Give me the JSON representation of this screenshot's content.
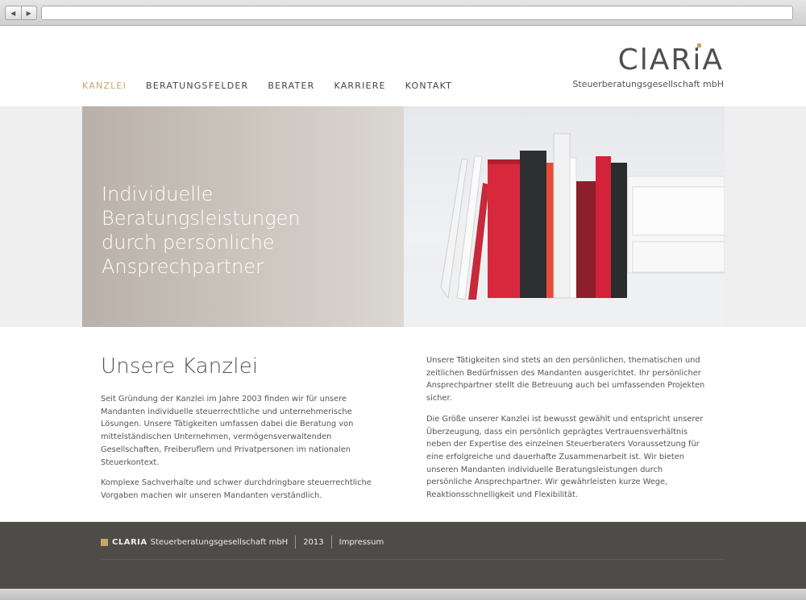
{
  "browser": {
    "back_label": "◀",
    "forward_label": "▶",
    "url": ""
  },
  "logo": {
    "wordmark": "ClARiA",
    "subtitle": "Steuerberatungsgesellschaft mbH"
  },
  "nav": {
    "items": [
      {
        "label": "KANZLEI",
        "active": true
      },
      {
        "label": "BERATUNGSFELDER"
      },
      {
        "label": "BERATER"
      },
      {
        "label": "KARRIERE"
      },
      {
        "label": "KONTAKT"
      }
    ]
  },
  "hero": {
    "lines": [
      "Individuelle",
      "Beratungsleistungen",
      "durch persönliche",
      "Ansprechpartner"
    ]
  },
  "content": {
    "title": "Unsere Kanzlei",
    "left_paragraphs": [
      "Seit Gründung der Kanzlei im Jahre 2003 finden wir für unsere Mandanten individuelle steuerrechtliche und unternehmerische Lösungen. Unsere Tätigkeiten umfassen dabei die Beratung von mittelständischen Unternehmen, vermögensverwaltenden Gesellschaften, Freiberuflern und Privatpersonen im nationalen Steuerkontext.",
      "Komplexe Sachverhalte und schwer durchdringbare steuerrechtliche Vorgaben machen wir unseren Mandanten verständlich."
    ],
    "right_paragraphs": [
      "Unsere Tätigkeiten sind stets an den persönlichen, thematischen und zeitlichen Bedürfnissen des Mandanten ausgerichtet. Ihr persönlicher Ansprechpartner stellt die Betreuung auch bei umfassenden Projekten sicher.",
      "Die Größe unserer Kanzlei ist bewusst gewählt und entspricht unserer Überzeugung, dass ein persönlich geprägtes Vertrauensverhältnis neben der Expertise des einzelnen Steuerberaters Voraussetzung für eine erfolgreiche und dauerhafte Zusammenarbeit ist. Wir bieten unseren Mandanten individuelle Beratungsleistungen durch persönliche Ansprechpartner. Wir gewährleisten kurze Wege, Reaktionsschnelligkeit und Flexibilität."
    ]
  },
  "footer": {
    "brand": "CLARIA",
    "company": "Steuerberatungsgesellschaft mbH",
    "year": "2013",
    "imprint": "Impressum"
  },
  "colors": {
    "accent": "#c9a56b",
    "footer_bg": "#4e4c48",
    "text": "#555555"
  }
}
